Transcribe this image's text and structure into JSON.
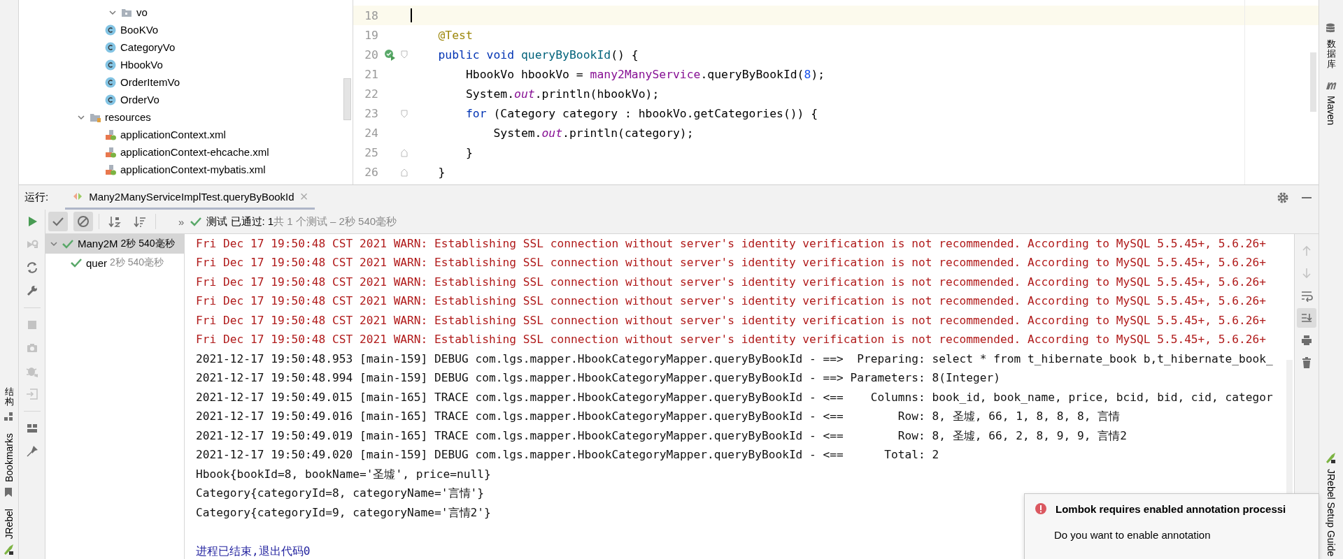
{
  "project_tree": [
    {
      "kind": "package",
      "label": "vo",
      "expanded": true,
      "children": [
        {
          "kind": "class",
          "label": "BooKVo"
        },
        {
          "kind": "class",
          "label": "CategoryVo"
        },
        {
          "kind": "class",
          "label": "HbookVo"
        },
        {
          "kind": "class",
          "label": "OrderItemVo"
        },
        {
          "kind": "class",
          "label": "OrderVo"
        }
      ]
    },
    {
      "kind": "resources",
      "label": "resources",
      "expanded": true,
      "children": [
        {
          "kind": "xml",
          "label": "applicationContext.xml"
        },
        {
          "kind": "xml",
          "label": "applicationContext-ehcache.xml"
        },
        {
          "kind": "xml",
          "label": "applicationContext-mybatis.xml"
        }
      ]
    }
  ],
  "editor": {
    "lines": [
      {
        "number": "18",
        "current": true
      },
      {
        "number": "19",
        "current": false,
        "tokens": [
          {
            "t": "    @Test",
            "kind": "annotation"
          }
        ]
      },
      {
        "number": "20",
        "current": false,
        "run_marker": true,
        "fold_start": true,
        "tokens": [
          {
            "t": "    public void",
            "kind": "keyword"
          },
          {
            "t": " queryByBookId",
            "kind": "method"
          },
          {
            "t": "() {",
            "kind": "plain"
          }
        ]
      },
      {
        "number": "21",
        "current": false,
        "tokens": [
          {
            "t": "        HbookVo hbookVo = ",
            "kind": "plain"
          },
          {
            "t": "many2ManyService",
            "kind": "field"
          },
          {
            "t": ".queryByBookId(",
            "kind": "plain"
          },
          {
            "t": "8",
            "kind": "number"
          },
          {
            "t": ");",
            "kind": "plain"
          }
        ]
      },
      {
        "number": "22",
        "current": false,
        "tokens": [
          {
            "t": "        System.",
            "kind": "plain"
          },
          {
            "t": "out",
            "kind": "static"
          },
          {
            "t": ".println(hbookVo);",
            "kind": "plain"
          }
        ]
      },
      {
        "number": "23",
        "current": false,
        "fold_start": true,
        "tokens": [
          {
            "t": "        for",
            "kind": "keyword"
          },
          {
            "t": " (Category category : hbookVo.getCategories()) {",
            "kind": "plain"
          }
        ]
      },
      {
        "number": "24",
        "current": false,
        "tokens": [
          {
            "t": "            System.",
            "kind": "plain"
          },
          {
            "t": "out",
            "kind": "static"
          },
          {
            "t": ".println(category);",
            "kind": "plain"
          }
        ]
      },
      {
        "number": "25",
        "current": false,
        "fold_end": true,
        "tokens": [
          {
            "t": "        }",
            "kind": "plain"
          }
        ]
      },
      {
        "number": "26",
        "current": false,
        "fold_end": true,
        "tokens": [
          {
            "t": "    }",
            "kind": "plain"
          }
        ]
      }
    ]
  },
  "run_panel": {
    "label": "运行:",
    "tabs": [
      {
        "title": "Many2ManyServiceImplTest.queryByBookId",
        "close": "×",
        "selected": true
      }
    ],
    "toolbar": [
      {
        "kind": "show-passed",
        "pressed": true
      },
      {
        "kind": "show-ignored",
        "pressed": true
      },
      {
        "kind": "sort-alpha",
        "pressed": false
      },
      {
        "kind": "sort-duration",
        "pressed": false
      }
    ],
    "more": "»",
    "status": {
      "passed": true,
      "label": "测试 已通过: 1",
      "summary": "共 1 个测试 – 2秒 540毫秒"
    },
    "side_actions": [
      {
        "kind": "run",
        "enabled": true
      },
      {
        "kind": "rerun-failed",
        "enabled": false
      },
      {
        "kind": "toggle-auto",
        "enabled": true
      },
      {
        "kind": "wrench",
        "enabled": true
      },
      {
        "kind": "stop",
        "enabled": false
      },
      {
        "kind": "camera",
        "enabled": false
      },
      {
        "kind": "export",
        "enabled": false
      },
      {
        "kind": "import",
        "enabled": false
      },
      {
        "kind": "layout",
        "enabled": true
      },
      {
        "kind": "pin",
        "enabled": true
      }
    ],
    "tests": [
      {
        "label": "Many2M",
        "time": "2秒 540毫秒",
        "passed": true,
        "expanded": true,
        "selected": true,
        "children": [
          {
            "label": "quer",
            "time": "2秒 540毫秒",
            "passed": true,
            "selected": false
          }
        ]
      }
    ],
    "console": [
      {
        "kind": "warn",
        "text": "Fri Dec 17 19:50:48 CST 2021 WARN: Establishing SSL connection without server's identity verification is not recommended. According to MySQL 5.5.45+, 5.6.26+"
      },
      {
        "kind": "warn",
        "text": "Fri Dec 17 19:50:48 CST 2021 WARN: Establishing SSL connection without server's identity verification is not recommended. According to MySQL 5.5.45+, 5.6.26+"
      },
      {
        "kind": "warn",
        "text": "Fri Dec 17 19:50:48 CST 2021 WARN: Establishing SSL connection without server's identity verification is not recommended. According to MySQL 5.5.45+, 5.6.26+"
      },
      {
        "kind": "warn",
        "text": "Fri Dec 17 19:50:48 CST 2021 WARN: Establishing SSL connection without server's identity verification is not recommended. According to MySQL 5.5.45+, 5.6.26+"
      },
      {
        "kind": "warn",
        "text": "Fri Dec 17 19:50:48 CST 2021 WARN: Establishing SSL connection without server's identity verification is not recommended. According to MySQL 5.5.45+, 5.6.26+"
      },
      {
        "kind": "warn",
        "text": "Fri Dec 17 19:50:48 CST 2021 WARN: Establishing SSL connection without server's identity verification is not recommended. According to MySQL 5.5.45+, 5.6.26+"
      },
      {
        "kind": "log",
        "text": "2021-12-17 19:50:48.953 [main-159] DEBUG com.lgs.mapper.HbookCategoryMapper.queryByBookId - ==>  Preparing: select * from t_hibernate_book b,t_hibernate_book_"
      },
      {
        "kind": "log",
        "text": "2021-12-17 19:50:48.994 [main-159] DEBUG com.lgs.mapper.HbookCategoryMapper.queryByBookId - ==> Parameters: 8(Integer)"
      },
      {
        "kind": "log",
        "text": "2021-12-17 19:50:49.015 [main-165] TRACE com.lgs.mapper.HbookCategoryMapper.queryByBookId - <==    Columns: book_id, book_name, price, bcid, bid, cid, categor"
      },
      {
        "kind": "log",
        "text": "2021-12-17 19:50:49.016 [main-165] TRACE com.lgs.mapper.HbookCategoryMapper.queryByBookId - <==        Row: 8, 圣墟, 66, 1, 8, 8, 8, 言情"
      },
      {
        "kind": "log",
        "text": "2021-12-17 19:50:49.019 [main-165] TRACE com.lgs.mapper.HbookCategoryMapper.queryByBookId - <==        Row: 8, 圣墟, 66, 2, 8, 9, 9, 言情2"
      },
      {
        "kind": "log",
        "text": "2021-12-17 19:50:49.020 [main-159] DEBUG com.lgs.mapper.HbookCategoryMapper.queryByBookId - <==      Total: 2"
      },
      {
        "kind": "output",
        "text": "Hbook{bookId=8, bookName='圣墟', price=null}"
      },
      {
        "kind": "output",
        "text": "Category{categoryId=8, categoryName='言情'}"
      },
      {
        "kind": "output",
        "text": "Category{categoryId=9, categoryName='言情2'}"
      },
      {
        "kind": "exit",
        "text": "进程已结束,退出代码0"
      }
    ],
    "console_actions": [
      {
        "kind": "up",
        "pressed": false
      },
      {
        "kind": "down",
        "pressed": false
      },
      {
        "kind": "wrap",
        "pressed": false
      },
      {
        "kind": "scroll-end",
        "pressed": true
      },
      {
        "kind": "print",
        "pressed": false
      },
      {
        "kind": "trash",
        "pressed": false
      }
    ]
  },
  "left_tool_strip": [
    {
      "kind": "structure",
      "label": "结构"
    },
    {
      "kind": "bookmarks",
      "label": "Bookmarks"
    },
    {
      "kind": "jrebel",
      "label": "JRebel"
    }
  ],
  "right_tool_strip": {
    "top": [
      {
        "kind": "database",
        "label": "数据库"
      },
      {
        "kind": "maven",
        "label": "Maven"
      }
    ],
    "bottom": [
      {
        "kind": "jrebel",
        "label": "JRebel Setup Guide"
      }
    ]
  },
  "notification": {
    "kind": "error",
    "title": "Lombok requires enabled annotation processi",
    "body": "Do you want to enable annotation"
  }
}
